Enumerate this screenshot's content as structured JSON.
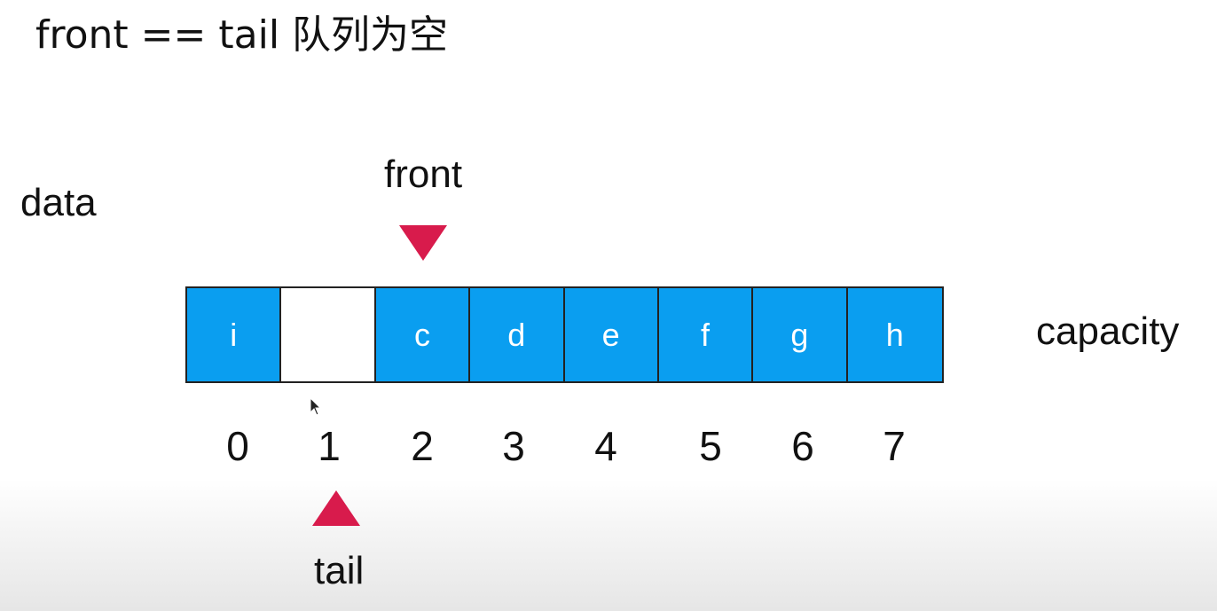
{
  "title": "front == tail 队列为空",
  "labels": {
    "data": "data",
    "front": "front",
    "tail": "tail",
    "capacity": "capacity"
  },
  "array": {
    "cells": [
      "i",
      "",
      "c",
      "d",
      "e",
      "f",
      "g",
      "h"
    ],
    "indices": [
      "0",
      "1",
      "2",
      "3",
      "4",
      "5",
      "6",
      "7"
    ],
    "front_index": 2,
    "tail_index": 1,
    "cell_color": "#0a9ef0",
    "empty_cell_color": "#ffffff"
  },
  "colors": {
    "pointer": "#d81b4c"
  },
  "icons": {
    "cursor": "mouse-pointer-icon"
  }
}
